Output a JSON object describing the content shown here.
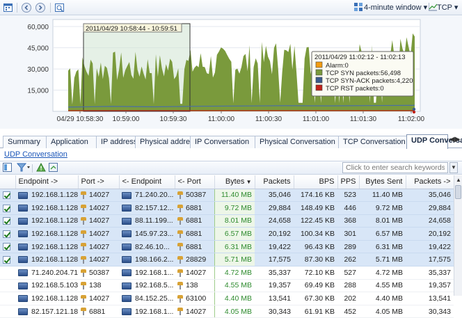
{
  "toolbar": {
    "window_label": "4-minute window",
    "protocol_label": "TCP"
  },
  "chart": {
    "y_ticks": [
      "60,000",
      "45,000",
      "30,000",
      "15,000"
    ],
    "x_ticks": [
      "04/29 10:58:30",
      "10:59:00",
      "10:59:30",
      "11:00:00",
      "11:00:30",
      "11:01:00",
      "11:01:30",
      "11:02:00"
    ],
    "selection_label": "2011/04/29  10:58:44 - 10:59:51",
    "tooltip": {
      "title": "2011/04/29  11:02:12 - 11:02:13",
      "items": [
        {
          "label": "Alarm:0",
          "color": "#f39c12"
        },
        {
          "label": "TCP SYN packets:56,498",
          "color": "#7a9a3c"
        },
        {
          "label": "TCP SYN-ACK packets:4,220",
          "color": "#3a5a8c"
        },
        {
          "label": "TCP RST packets:0",
          "color": "#c0221a"
        }
      ]
    },
    "colors": {
      "syn": "#7a9a3c",
      "synack": "#4a6fa5",
      "rst": "#c0221a",
      "selection": "#cfe3d1"
    }
  },
  "chart_data": {
    "type": "area",
    "ylim": [
      0,
      65000
    ],
    "x": [
      "10:58:30",
      "10:59:00",
      "10:59:30",
      "11:00:00",
      "11:00:30",
      "11:01:00",
      "11:01:30",
      "11:02:00",
      "11:02:12"
    ],
    "series": [
      {
        "name": "TCP SYN packets",
        "values": [
          40000,
          43000,
          42000,
          45000,
          47000,
          52000,
          48000,
          50000,
          56498
        ]
      },
      {
        "name": "TCP SYN-ACK packets",
        "values": [
          3000,
          3500,
          3200,
          3600,
          3800,
          4000,
          3900,
          4100,
          4220
        ]
      },
      {
        "name": "TCP RST packets",
        "values": [
          0,
          0,
          0,
          0,
          0,
          0,
          0,
          0,
          0
        ]
      },
      {
        "name": "Alarm",
        "values": [
          0,
          0,
          0,
          0,
          0,
          0,
          0,
          0,
          0
        ]
      }
    ]
  },
  "tabs": [
    "Summary",
    "Application",
    "IP address",
    "Physical address",
    "IP Conversation",
    "Physical Conversation",
    "TCP Conversation",
    "UDP Conversation"
  ],
  "active_tab": "UDP Conversation",
  "sub_link": "UDP Conversation",
  "search": {
    "placeholder": "Click to enter search keywords."
  },
  "table": {
    "columns": [
      "",
      "Endpoint ->",
      "Port ->",
      "<- Endpoint",
      "<- Port",
      "Bytes",
      "Packets",
      "BPS",
      "PPS",
      "Bytes Sent",
      "Packets ->"
    ],
    "rows": [
      {
        "sel": true,
        "ep1": "192.168.1.128",
        "p1": "14027",
        "ep2": "71.240.20...",
        "p2": "50387",
        "bytes": "11.40 MB",
        "packets": "35,046",
        "bps": "174.16 KB",
        "pps": "523",
        "sent": "11.40 MB",
        "pk_out": "35,046"
      },
      {
        "sel": true,
        "ep1": "192.168.1.128",
        "p1": "14027",
        "ep2": "82.157.12...",
        "p2": "6881",
        "bytes": "9.72 MB",
        "packets": "29,884",
        "bps": "148.49 KB",
        "pps": "446",
        "sent": "9.72 MB",
        "pk_out": "29,884"
      },
      {
        "sel": true,
        "ep1": "192.168.1.128",
        "p1": "14027",
        "ep2": "88.11.199...",
        "p2": "6881",
        "bytes": "8.01 MB",
        "packets": "24,658",
        "bps": "122.45 KB",
        "pps": "368",
        "sent": "8.01 MB",
        "pk_out": "24,658"
      },
      {
        "sel": true,
        "ep1": "192.168.1.128",
        "p1": "14027",
        "ep2": "145.97.23...",
        "p2": "6881",
        "bytes": "6.57 MB",
        "packets": "20,192",
        "bps": "100.34 KB",
        "pps": "301",
        "sent": "6.57 MB",
        "pk_out": "20,192"
      },
      {
        "sel": true,
        "ep1": "192.168.1.128",
        "p1": "14027",
        "ep2": "82.46.10...",
        "p2": "6881",
        "bytes": "6.31 MB",
        "packets": "19,422",
        "bps": "96.43 KB",
        "pps": "289",
        "sent": "6.31 MB",
        "pk_out": "19,422"
      },
      {
        "sel": true,
        "ep1": "192.168.1.128",
        "p1": "14027",
        "ep2": "198.166.2...",
        "p2": "28829",
        "bytes": "5.71 MB",
        "packets": "17,575",
        "bps": "87.30 KB",
        "pps": "262",
        "sent": "5.71 MB",
        "pk_out": "17,575"
      },
      {
        "sel": false,
        "ep1": "71.240.204.71",
        "p1": "50387",
        "ep2": "192.168.1...",
        "p2": "14027",
        "bytes": "4.72 MB",
        "packets": "35,337",
        "bps": "72.10 KB",
        "pps": "527",
        "sent": "4.72 MB",
        "pk_out": "35,337"
      },
      {
        "sel": false,
        "ep1": "192.168.5.103",
        "p1": "138",
        "ep2": "192.168.5...",
        "p2": "138",
        "bytes": "4.55 MB",
        "packets": "19,357",
        "bps": "69.49 KB",
        "pps": "288",
        "sent": "4.55 MB",
        "pk_out": "19,357"
      },
      {
        "sel": false,
        "ep1": "192.168.1.128",
        "p1": "14027",
        "ep2": "84.152.25...",
        "p2": "63100",
        "bytes": "4.40 MB",
        "packets": "13,541",
        "bps": "67.30 KB",
        "pps": "202",
        "sent": "4.40 MB",
        "pk_out": "13,541"
      },
      {
        "sel": false,
        "ep1": "82.157.121.180",
        "p1": "6881",
        "ep2": "192.168.1...",
        "p2": "14027",
        "bytes": "4.05 MB",
        "packets": "30,343",
        "bps": "61.91 KB",
        "pps": "452",
        "sent": "4.05 MB",
        "pk_out": "30,343"
      }
    ]
  }
}
